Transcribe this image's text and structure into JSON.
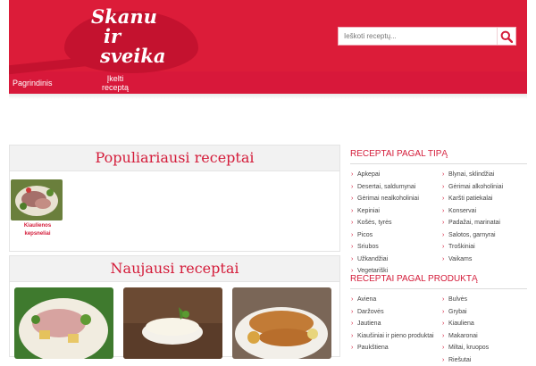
{
  "header": {
    "logo_text": "Skanu ir sveika",
    "logo_line1": "Skanu",
    "logo_line2": "ir",
    "logo_line3": "sveika",
    "search_placeholder": "Ieškoti receptų...",
    "nav": [
      {
        "label": "Pagrindinis"
      },
      {
        "label": "Įkelti receptą"
      }
    ]
  },
  "popular": {
    "title": "Populiariausi receptai",
    "items": [
      {
        "caption": "Kiaulienos kepsneliai"
      }
    ]
  },
  "newest": {
    "title": "Naujausi receptai"
  },
  "sidebar": {
    "by_type": {
      "title": "RECEPTAI PAGAL TIPĄ",
      "items": [
        "Apkepai",
        "Blynai, sklindžiai",
        "Desertai, saldumynai",
        "Gėrimai alkoholiniai",
        "Gėrimai nealkoholiniai",
        "Karšti patiekalai",
        "Kepiniai",
        "Konservai",
        "Košės, tyrės",
        "Padažai, marinatai",
        "Picos",
        "Salotos, garnyrai",
        "Sriubos",
        "Troškiniai",
        "Užkandžiai",
        "Vaikams",
        "Vegetariški"
      ]
    },
    "by_product": {
      "title": "RECEPTAI PAGAL PRODUKTĄ",
      "items": [
        "Aviena",
        "Bulvės",
        "Daržovės",
        "Grybai",
        "Jautiena",
        "Kiauliena",
        "Kiaušiniai ir pieno produktai",
        "Makaronai",
        "Paukštiena",
        "Miltai, kruopos",
        "",
        "Riešutai"
      ]
    }
  },
  "colors": {
    "brand": "#dc1c39",
    "accent": "#d41c3a"
  }
}
